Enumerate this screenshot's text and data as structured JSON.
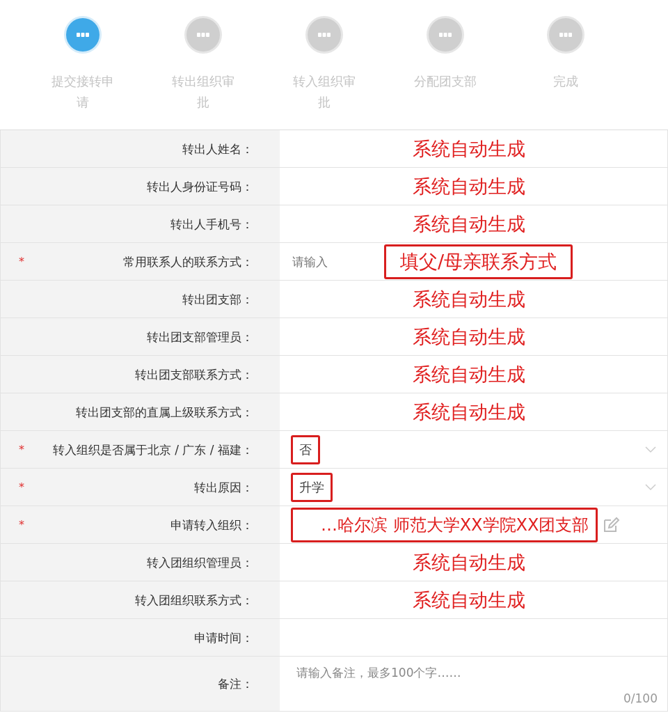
{
  "steps": [
    {
      "label": "提交接转申请",
      "selected": true
    },
    {
      "label": "转出组织审批",
      "selected": false
    },
    {
      "label": "转入组织审批",
      "selected": false
    },
    {
      "label": "分配团支部",
      "selected": false
    },
    {
      "label": "完成",
      "selected": false
    }
  ],
  "rows": [
    {
      "label": "转出人姓名：",
      "kind": "auto",
      "note": "系统自动生成"
    },
    {
      "label": "转出人身份证号码：",
      "kind": "auto",
      "note": "系统自动生成"
    },
    {
      "label": "转出人手机号：",
      "kind": "auto",
      "note": "系统自动生成"
    },
    {
      "label": "常用联系人的联系方式：",
      "mark": "*",
      "kind": "input",
      "placeholder": "请输入",
      "note": "填父/母亲联系方式"
    },
    {
      "label": "转出团支部：",
      "kind": "auto",
      "note": "系统自动生成"
    },
    {
      "label": "转出团支部管理员：",
      "kind": "auto",
      "note": "系统自动生成"
    },
    {
      "label": "转出团支部联系方式：",
      "kind": "auto",
      "note": "系统自动生成"
    },
    {
      "label": "转出团支部的直属上级联系方式：",
      "kind": "auto",
      "note": "系统自动生成"
    },
    {
      "label": "转入组织是否属于北京 / 广东 / 福建：",
      "mark": "*",
      "kind": "select",
      "value": "否",
      "highlighted": true
    },
    {
      "label": "转出原因：",
      "mark": "*",
      "kind": "select",
      "value": "升学",
      "highlighted": true
    },
    {
      "label": "申请转入组织：",
      "mark": "*",
      "kind": "picker",
      "note": "…哈尔滨 师范大学XX学院XX团支部"
    },
    {
      "label": "转入团组织管理员：",
      "kind": "auto",
      "note": "系统自动生成"
    },
    {
      "label": "转入团组织联系方式：",
      "kind": "auto",
      "note": "系统自动生成"
    },
    {
      "label": "申请时间：",
      "kind": "blank"
    },
    {
      "label": "备注：",
      "kind": "textarea",
      "placeholder": "请输入备注，最多100个字……",
      "counter": "0/100"
    }
  ]
}
